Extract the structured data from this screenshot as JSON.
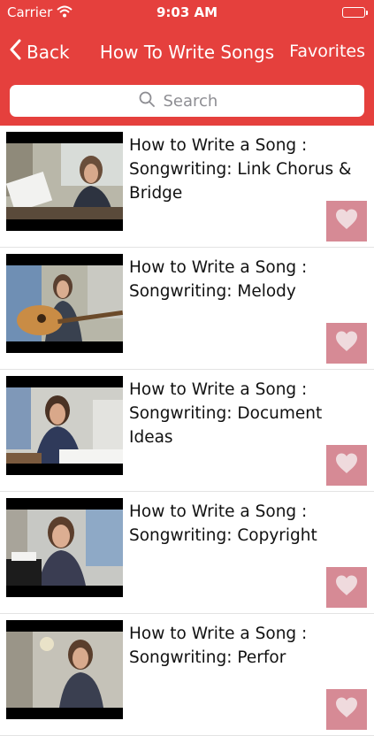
{
  "status_bar": {
    "carrier": "Carrier",
    "time": "9:03 AM",
    "battery_level": 1.0
  },
  "nav": {
    "back_label": "Back",
    "title": "How To Write Songs",
    "favorites_label": "Favorites"
  },
  "search": {
    "placeholder": "Search",
    "value": ""
  },
  "colors": {
    "accent": "#e5403d",
    "favorite_bg": "#d68a95"
  },
  "videos": [
    {
      "title": "How to Write a Song : Songwriting: Link Chorus & Bridge"
    },
    {
      "title": "How to Write a Song : Songwriting: Melody"
    },
    {
      "title": "How to Write a Song : Songwriting: Document Ideas"
    },
    {
      "title": "How to Write a Song : Songwriting: Copyright"
    },
    {
      "title": "How to Write a Song : Songwriting: Perfor"
    }
  ]
}
